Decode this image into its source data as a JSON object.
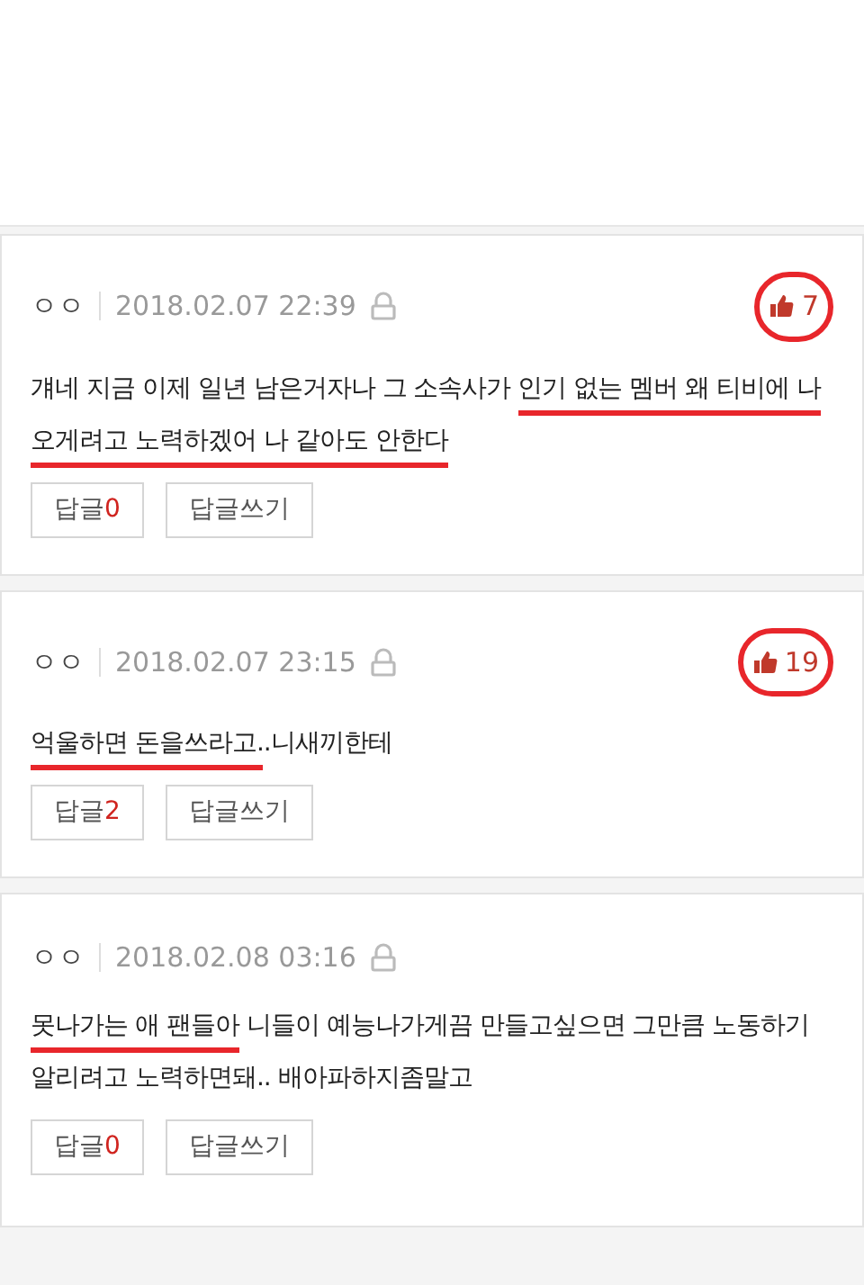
{
  "comments": [
    {
      "author": "ㅇㅇ",
      "date": "2018.02.07 22:39",
      "likes": "7",
      "likes_circled": true,
      "segments": [
        {
          "text": "걔네 지금 이제 일년 남은거자나 그 소속사가 ",
          "marked": false
        },
        {
          "text": "인기 없는 멤버 왜 티비에 나오게려고 노력하겠어 나 같아도 안한다",
          "marked": true
        }
      ],
      "reply_label": "답글",
      "reply_count": "0",
      "write_label": "답글쓰기"
    },
    {
      "author": "ㅇㅇ",
      "date": "2018.02.07 23:15",
      "likes": "19",
      "likes_circled": true,
      "segments": [
        {
          "text": "억울하면 돈을쓰라고.",
          "marked": true
        },
        {
          "text": ".니새끼한테",
          "marked": false
        }
      ],
      "reply_label": "답글",
      "reply_count": "2",
      "write_label": "답글쓰기"
    },
    {
      "author": "ㅇㅇ",
      "date": "2018.02.08 03:16",
      "segments": [
        {
          "text": "못나가는 애 팬들아",
          "marked": true
        },
        {
          "text": " 니들이 예능나가게끔 만들고싶으면 그만큼 노동하기 알리려고 노력하면돼.. 배아파하지좀말고",
          "marked": false
        }
      ],
      "reply_label": "답글",
      "reply_count": "0",
      "write_label": "답글쓰기"
    }
  ]
}
